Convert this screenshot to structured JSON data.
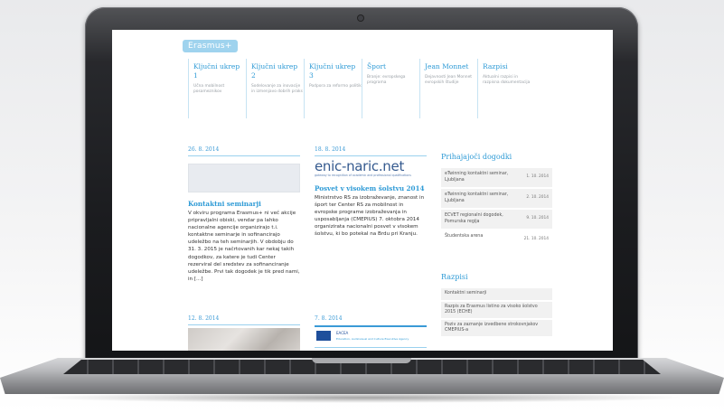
{
  "site": {
    "logo_text": "Erasmus+"
  },
  "nav": [
    {
      "title": "Ključni ukrep 1",
      "desc": "Učna mobilnost posameznikov"
    },
    {
      "title": "Ključni ukrep 2",
      "desc": "Sodelovanje za inovacije in izmenjavo dobrih praks"
    },
    {
      "title": "Ključni ukrep 3",
      "desc": "Podpora za reformo politik"
    },
    {
      "title": "Šport",
      "desc": "Branje: evropskega programa"
    },
    {
      "title": "Jean Monnet",
      "desc": "Dejavnosti Jean Monnet evropskih študije"
    },
    {
      "title": "Razpisi",
      "desc": "Aktualni razpisi in razpisna dokumentacija"
    }
  ],
  "col1": {
    "date": "26. 8. 2014",
    "title": "Kontaktni seminarji",
    "body": "V okviru programa Erasmus+ ni več akcije pripravljalni obiski, vendar pa lahko nacionalne agencije organizirajo t.i. kontaktne seminarje in sofinancirajo udeležbo na teh seminarjih. V obdobju do 31. 3. 2015 je načrtovanih kar nekaj takih dogodkov, za katere je tudi Center rezerviral del sredstev za sofinanciranje udeležbe. Prvi tak dogodek je tik pred nami, in [...]",
    "date2": "12. 8. 2014"
  },
  "col2": {
    "date": "18. 8. 2014",
    "logo_text": "enic-naric.net",
    "logo_sub": "gateway to recognition of academic and professional qualifications",
    "title": "Posvet v visokem šolstvu 2014",
    "body": "Ministrstvo RS za izobraževanje, znanost in šport ter Center RS za mobilnost in evropske programe izobraževanja in usposabljanja (CMEPIUS) 7. oktobra 2014 organizirata nacionalni posvet v visokem šolstvu, ki bo potekal na Brdu pri Kranju.",
    "date2": "7. 8. 2014",
    "banner_text": "EACEA",
    "banner_sub": "Education, Audiovisual and Culture Executive Agency"
  },
  "sidebar": {
    "events_heading": "Prihajajoči dogodki",
    "events": [
      {
        "text": "eTwinning kontaktni seminar, Ljubljana",
        "date": "1. 10. 2014"
      },
      {
        "text": "eTwinning kontaktni seminar, Ljubljana",
        "date": "2. 10. 2014"
      },
      {
        "text": "ECVET regionalni dogodek, Pomurska regija",
        "date": "9. 10. 2014"
      },
      {
        "text": "Študentska arena",
        "date": "21. 10. 2014"
      }
    ],
    "tenders_heading": "Razpisi",
    "tenders": [
      "Kontaktni seminarji",
      "Razpis za Erasmus listino za visoko šolstvo 2015 (ECHE)",
      "Poziv za zaznanje izvedbene strokovnjakov CMEPIUS-a"
    ]
  }
}
